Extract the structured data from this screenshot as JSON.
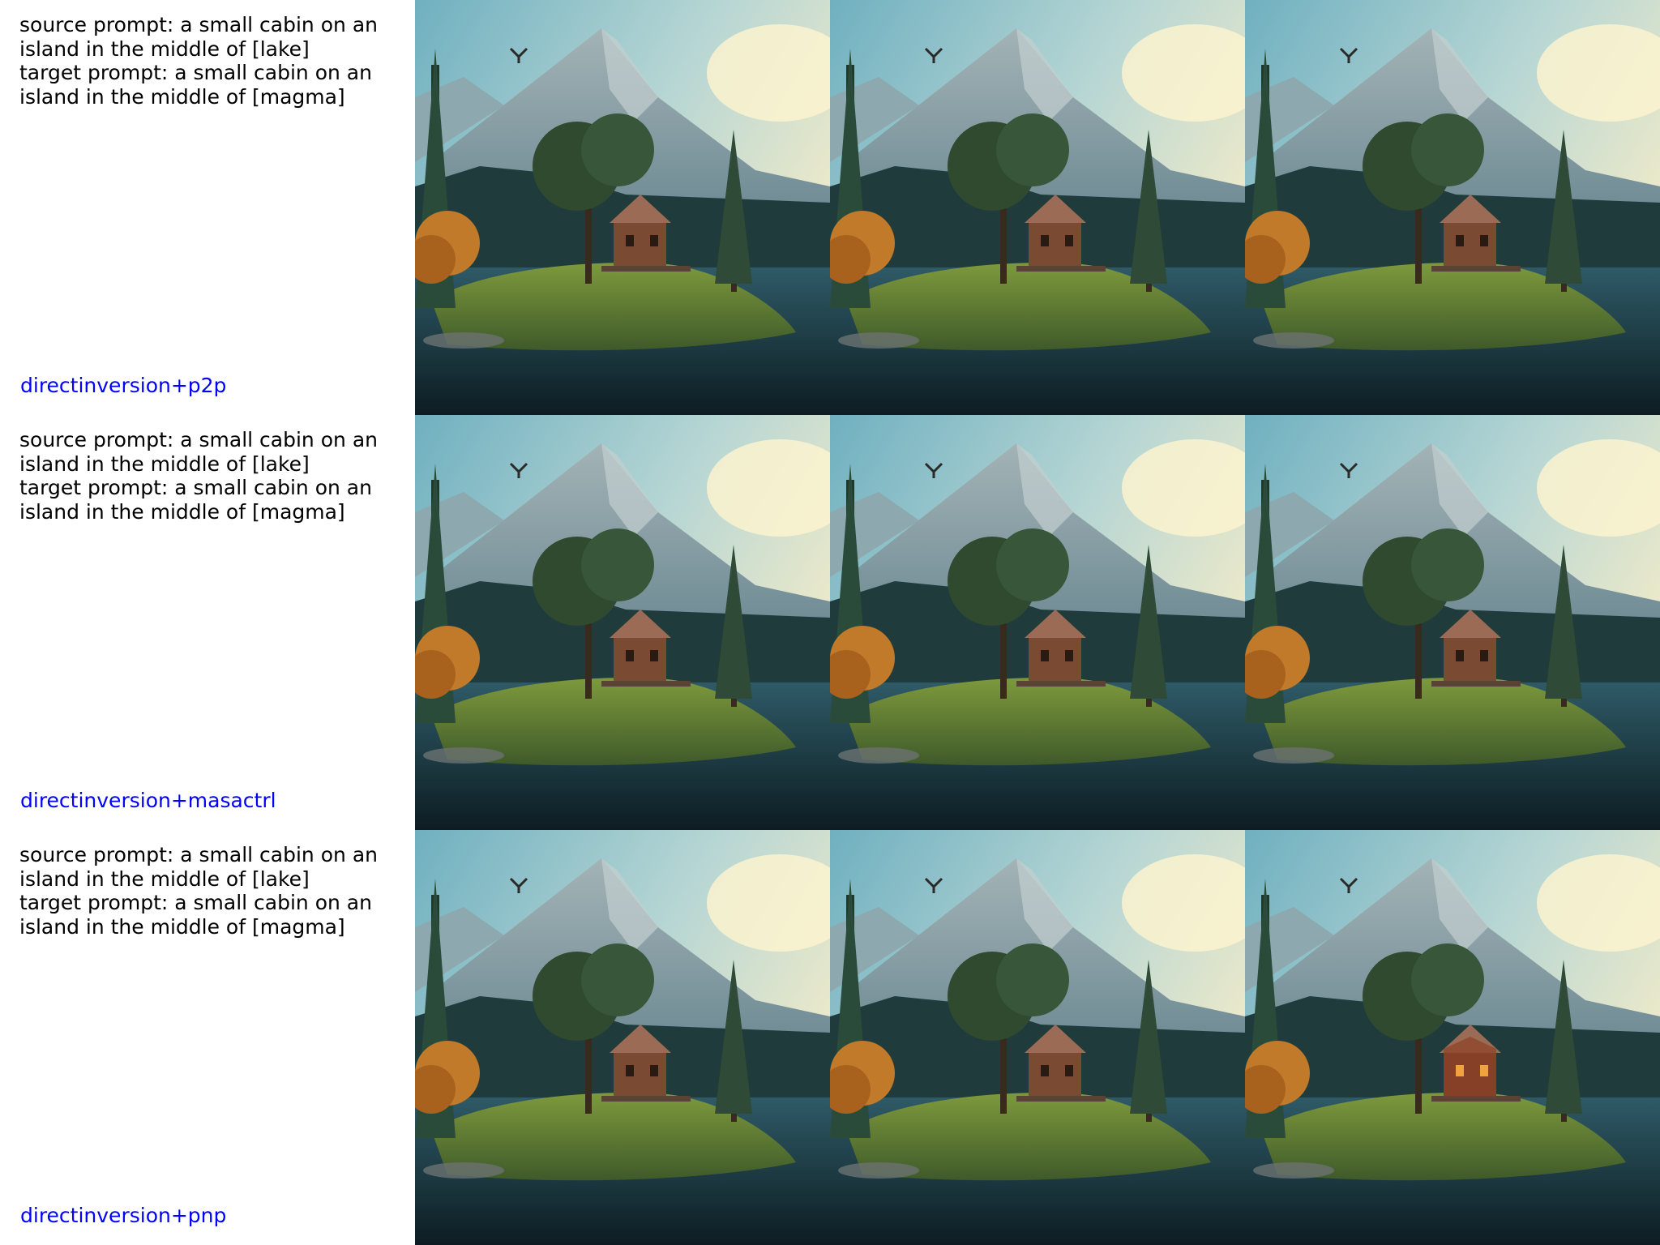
{
  "rows": [
    {
      "caption": [
        "source prompt: a small cabin on an",
        "island in the middle of [lake]",
        "target prompt: a small cabin on an",
        "island in the middle of [magma]"
      ],
      "method": "directinversion+p2p"
    },
    {
      "caption": [
        "source prompt: a small cabin on an",
        "island in the middle of [lake]",
        "target prompt: a small cabin on an",
        "island in the middle of [magma]"
      ],
      "method": "directinversion+masactrl"
    },
    {
      "caption": [
        "source prompt: a small cabin on an",
        "island in the middle of [lake]",
        "target prompt: a small cabin on an",
        "island in the middle of [magma]"
      ],
      "method": "directinversion+pnp"
    }
  ],
  "colors": {
    "method_label": "#0000ff",
    "caption_text": "#000000",
    "cabin_original": "#7a4a32",
    "cabin_edited_warm": "#8c3b20"
  },
  "image_descriptions": {
    "scene": "mountain lake with small wooden cabin on grassy island, pine trees, orange autumn tree, bird in sky"
  }
}
